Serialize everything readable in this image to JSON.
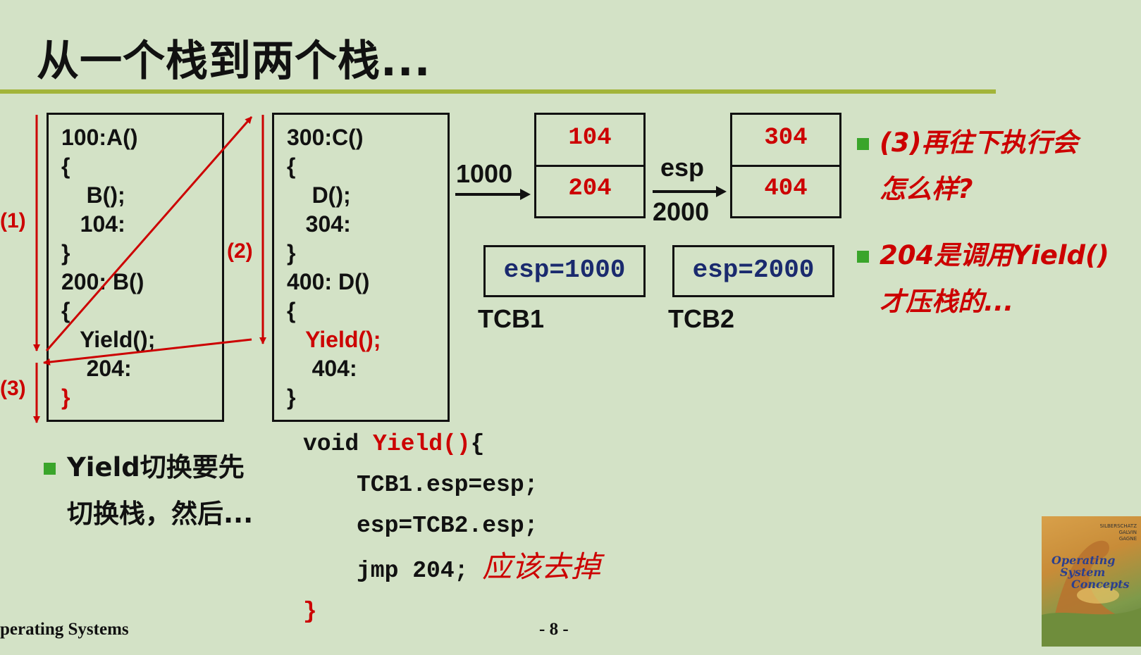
{
  "slide": {
    "title": "从一个栈到两个栈...",
    "footer_left": "perating Systems",
    "footer_page": "- 8 -"
  },
  "code_box_1": {
    "lines": [
      "100:A()",
      "{",
      "    B();",
      "   104:",
      "}",
      "200: B()",
      "{",
      "   Yield();",
      "    204:"
    ],
    "closing": "}"
  },
  "code_box_2": {
    "lines": [
      "300:C()",
      "{",
      "    D();",
      "   304:",
      "}",
      "400: D()",
      "{"
    ],
    "yield_line": "   Yield();",
    "after": [
      "    404:",
      "}"
    ]
  },
  "steps": {
    "s1": "(1)",
    "s2": "(2)",
    "s3": "(3)"
  },
  "stack1": {
    "top": "104",
    "bottom": "204",
    "pointer_label": "1000"
  },
  "stack2": {
    "top": "304",
    "bottom": "404",
    "pointer_label_top": "esp",
    "pointer_label_bottom": "2000"
  },
  "tcb1": {
    "value": "esp=1000",
    "label": "TCB1"
  },
  "tcb2": {
    "value": "esp=2000",
    "label": "TCB2"
  },
  "notes_right": {
    "n1_line1": "(3)再往下执行会",
    "n1_line2": "怎么样?",
    "n2_line1": "204是调用Yield()",
    "n2_line2": "才压栈的..."
  },
  "note_left": {
    "line1": "Yield切换要先",
    "line2": "切换栈，然后..."
  },
  "yield_code": {
    "void": "void ",
    "fname": "Yield()",
    "brace": "{",
    "line1": "TCB1.esp=esp;",
    "line2": "esp=TCB2.esp;",
    "line3": "jmp 204;",
    "comment": "应该去掉",
    "closing": "}"
  },
  "book_cover": {
    "title": [
      "Operating",
      "System",
      "Concepts"
    ],
    "authors": [
      "SILBERSCHATZ",
      "GALVIN",
      "GAGNE"
    ]
  },
  "colors": {
    "background": "#d3e2c6",
    "rule": "#a2b43a",
    "accent_red": "#cc0000",
    "bullet_green": "#3aa52b",
    "tcb_text": "#1a2a6e"
  }
}
